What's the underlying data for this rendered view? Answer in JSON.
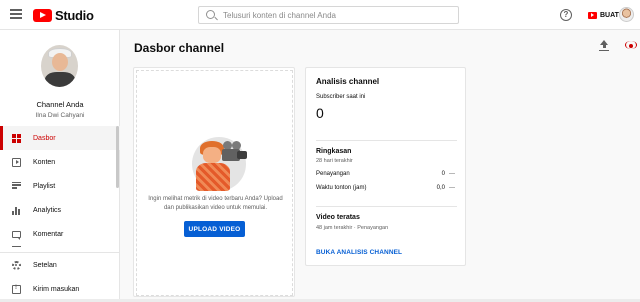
{
  "topbar": {
    "logo_text": "Studio",
    "search_placeholder": "Telusuri konten di channel Anda",
    "help_icon_glyph": "?",
    "create_label": "BUAT"
  },
  "sidebar": {
    "channel_name": "Channel Anda",
    "channel_subtitle": "Ilna Dwi Cahyani",
    "items": [
      {
        "label": "Dasbor",
        "icon": "dashboard-icon",
        "active": true
      },
      {
        "label": "Konten",
        "icon": "content-icon",
        "active": false
      },
      {
        "label": "Playlist",
        "icon": "playlist-icon",
        "active": false
      },
      {
        "label": "Analytics",
        "icon": "analytics-icon",
        "active": false
      },
      {
        "label": "Komentar",
        "icon": "comments-icon",
        "active": false
      }
    ],
    "bottom_items": [
      {
        "label": "Setelan",
        "icon": "gear-icon"
      },
      {
        "label": "Kirim masukan",
        "icon": "feedback-icon"
      }
    ]
  },
  "main": {
    "page_title": "Dasbor channel",
    "upload_card": {
      "prompt": "Ingin melihat metrik di video terbaru Anda? Upload dan publikasikan video untuk memulai.",
      "button_label": "UPLOAD VIDEO"
    },
    "analytics_card": {
      "title": "Analisis channel",
      "subscribers_label": "Subscriber saat ini",
      "subscribers_value": "0",
      "summary_title": "Ringkasan",
      "summary_period": "28 hari terakhir",
      "metrics": [
        {
          "label": "Penayangan",
          "value": "0",
          "trend": "—"
        },
        {
          "label": "Waktu tonton (jam)",
          "value": "0,0",
          "trend": "—"
        }
      ],
      "top_videos_title": "Video teratas",
      "top_videos_sub": "48 jam terakhir · Penayangan",
      "link_label": "BUKA ANALISIS CHANNEL"
    }
  },
  "colors": {
    "accent_red": "#cc0000",
    "brand_red": "#ff0000",
    "link_blue": "#065fd4"
  }
}
